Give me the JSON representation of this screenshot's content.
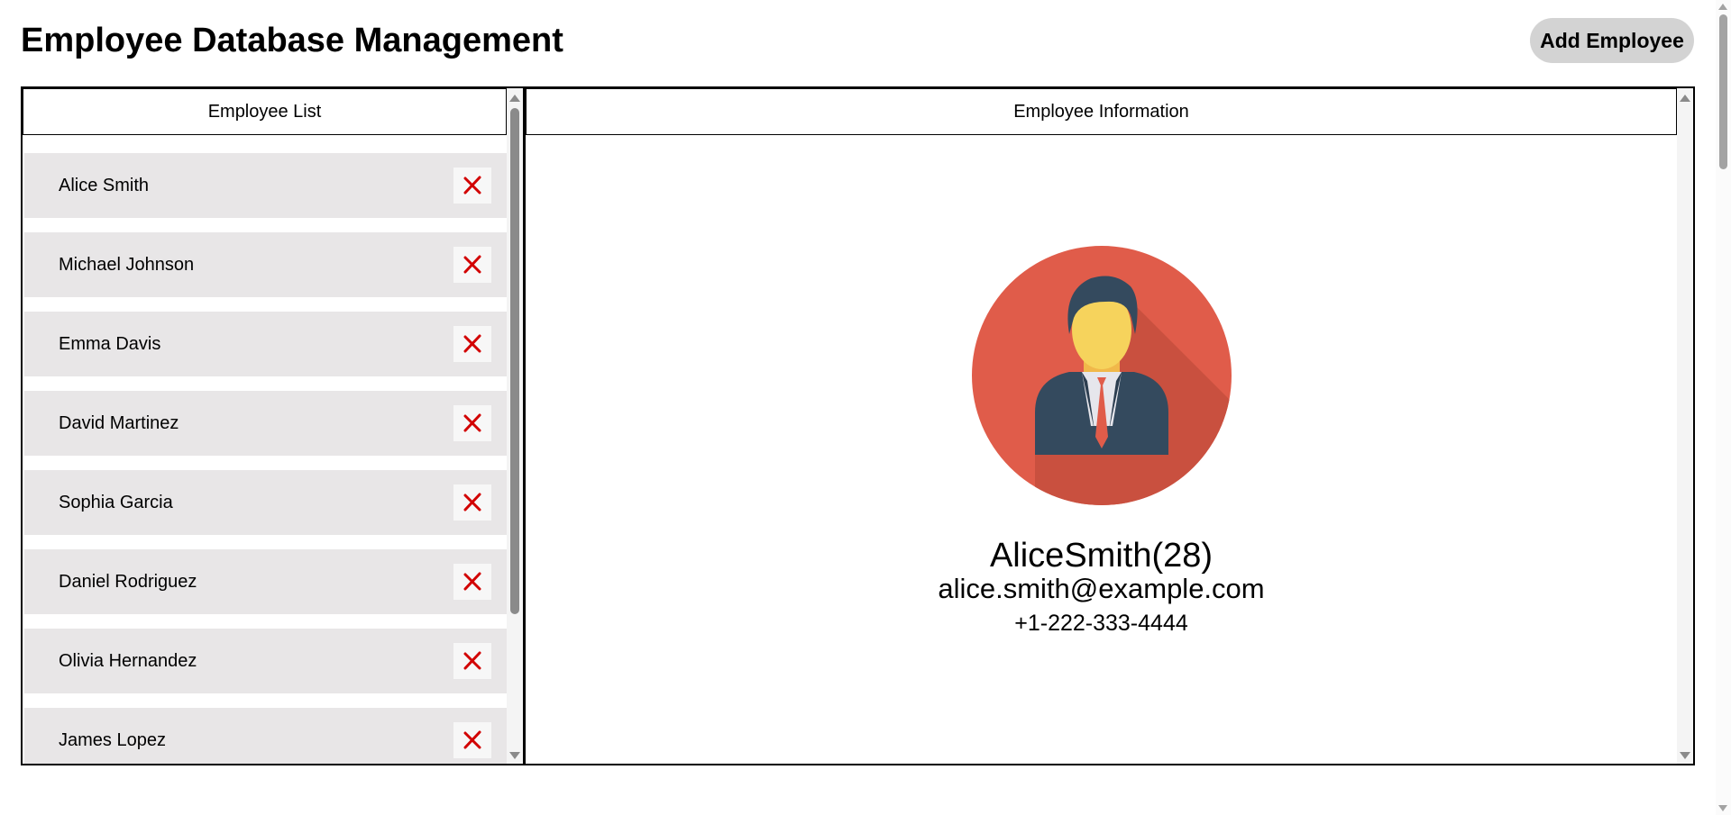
{
  "header": {
    "title": "Employee Database Management",
    "add_button_label": "Add Employee"
  },
  "list_panel": {
    "title": "Employee List",
    "delete_icon": "red-x-icon",
    "employees": [
      {
        "name": "Alice Smith"
      },
      {
        "name": "Michael Johnson"
      },
      {
        "name": "Emma Davis"
      },
      {
        "name": "David Martinez"
      },
      {
        "name": "Sophia Garcia"
      },
      {
        "name": "Daniel Rodriguez"
      },
      {
        "name": "Olivia Hernandez"
      },
      {
        "name": "James Lopez"
      }
    ]
  },
  "info_panel": {
    "title": "Employee Information",
    "avatar_icon": "businessman-avatar-icon",
    "selected": {
      "name_age": "AliceSmith(28)",
      "email": "alice.smith@example.com",
      "phone": "+1-222-333-4444"
    }
  },
  "colors": {
    "list_item_bg": "#e8e6e7",
    "delete_red": "#d20000",
    "avatar_circle": "#e05c4a",
    "button_bg": "#d3d3d3"
  }
}
